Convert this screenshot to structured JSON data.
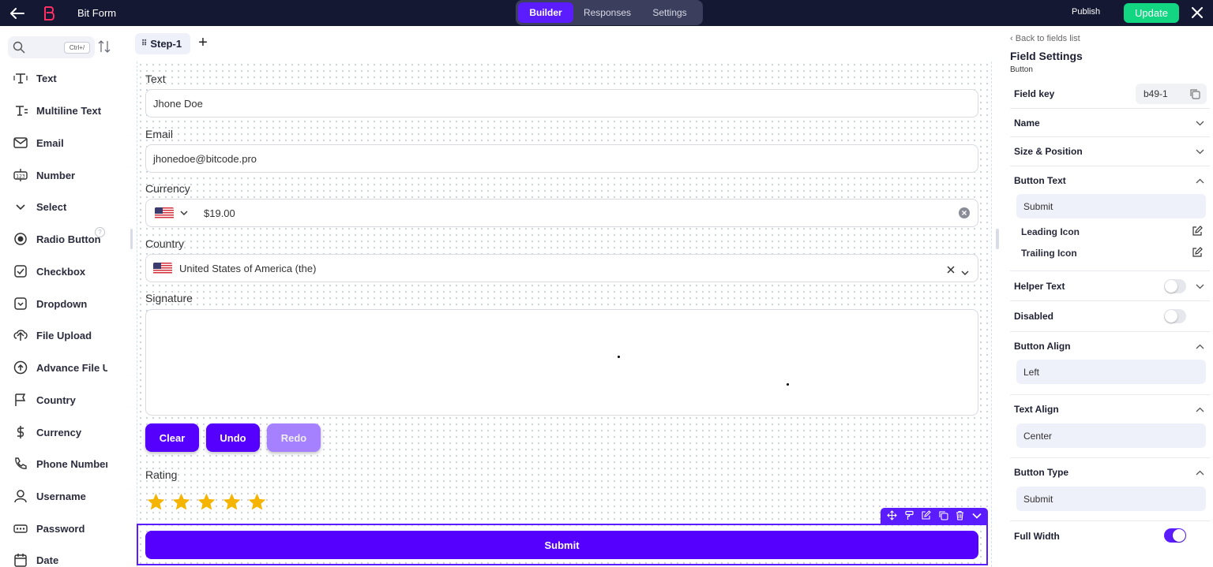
{
  "topbar": {
    "app_title": "Bit Form",
    "tabs": [
      {
        "label": "Builder",
        "active": true
      },
      {
        "label": "Responses",
        "active": false
      },
      {
        "label": "Settings",
        "active": false
      }
    ],
    "publish_label": "Publish",
    "update_label": "Update"
  },
  "sidebar": {
    "search_shortcut": "Ctrl+/",
    "fields": [
      {
        "label": "Text",
        "icon": "text-field-icon"
      },
      {
        "label": "Multiline Text",
        "icon": "multiline-text-icon"
      },
      {
        "label": "Email",
        "icon": "email-icon"
      },
      {
        "label": "Number",
        "icon": "number-icon"
      },
      {
        "label": "Select",
        "icon": "chevron-down-icon"
      },
      {
        "label": "Radio Button",
        "icon": "radio-icon"
      },
      {
        "label": "Checkbox",
        "icon": "checkbox-icon"
      },
      {
        "label": "Dropdown",
        "icon": "dropdown-icon"
      },
      {
        "label": "File Upload",
        "icon": "upload-icon"
      },
      {
        "label": "Advance File Upload",
        "icon": "advance-upload-icon"
      },
      {
        "label": "Country",
        "icon": "flag-icon"
      },
      {
        "label": "Currency",
        "icon": "dollar-icon"
      },
      {
        "label": "Phone Number",
        "icon": "phone-icon"
      },
      {
        "label": "Username",
        "icon": "user-icon"
      },
      {
        "label": "Password",
        "icon": "password-icon"
      },
      {
        "label": "Date",
        "icon": "calendar-icon"
      }
    ]
  },
  "builder": {
    "step_label": "Step-1",
    "text_field": {
      "label": "Text",
      "value": "Jhone Doe"
    },
    "email_field": {
      "label": "Email",
      "value": "jhonedoe@bitcode.pro"
    },
    "currency_field": {
      "label": "Currency",
      "value": "$19.00"
    },
    "country_field": {
      "label": "Country",
      "value": "United States of America (the)"
    },
    "signature": {
      "label": "Signature",
      "clear": "Clear",
      "undo": "Undo",
      "redo": "Redo"
    },
    "rating": {
      "label": "Rating",
      "stars": 5,
      "color": "#f5b400"
    },
    "submit_label": "Submit"
  },
  "settings": {
    "back_label": "Back to fields list",
    "title": "Field Settings",
    "subtitle": "Button",
    "field_key_label": "Field key",
    "field_key_value": "b49-1",
    "name_label": "Name",
    "size_label": "Size & Position",
    "button_text_label": "Button Text",
    "button_text_value": "Submit",
    "leading_icon": "Leading Icon",
    "trailing_icon": "Trailing Icon",
    "helper_text": "Helper Text",
    "disabled": "Disabled",
    "button_align_label": "Button Align",
    "button_align_value": "Left",
    "text_align_label": "Text Align",
    "text_align_value": "Center",
    "button_type_label": "Button Type",
    "button_type_value": "Submit",
    "full_width": "Full Width"
  },
  "colors": {
    "accent": "#5500ff",
    "topbar": "#141833",
    "update": "#12d681"
  }
}
